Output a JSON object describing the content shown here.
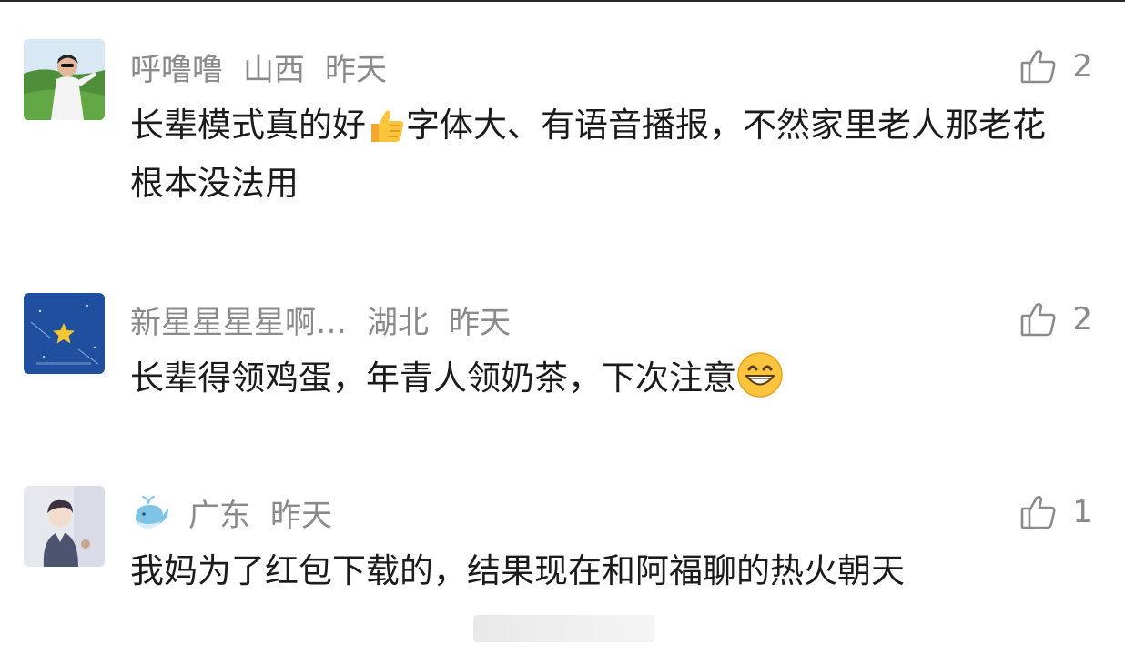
{
  "comments": [
    {
      "username": "呼噜噜",
      "location": "山西",
      "time": "昨天",
      "likes": "2",
      "content_before_emoji": " 长辈模式真的好",
      "emoji": "thumbs-up",
      "content_after_emoji": "字体大、有语音播报，不然家里老人那老花根本没法用"
    },
    {
      "username": "新星星星星啊…",
      "location": "湖北",
      "time": "昨天",
      "likes": "2",
      "content_before_emoji": "长辈得领鸡蛋，年青人领奶茶，下次注意",
      "emoji": "grinning-face"
    },
    {
      "username_icon": "whale-icon",
      "location": "广东",
      "time": "昨天",
      "likes": "1",
      "content_before_emoji": "我妈为了红包下载的，结果现在和阿福聊的热火朝天"
    }
  ],
  "colors": {
    "meta_text": "#8a8a8a",
    "body_text": "#1b1b1b",
    "avatar2_bg": "#1f4f9e",
    "star": "#f7c62f"
  }
}
